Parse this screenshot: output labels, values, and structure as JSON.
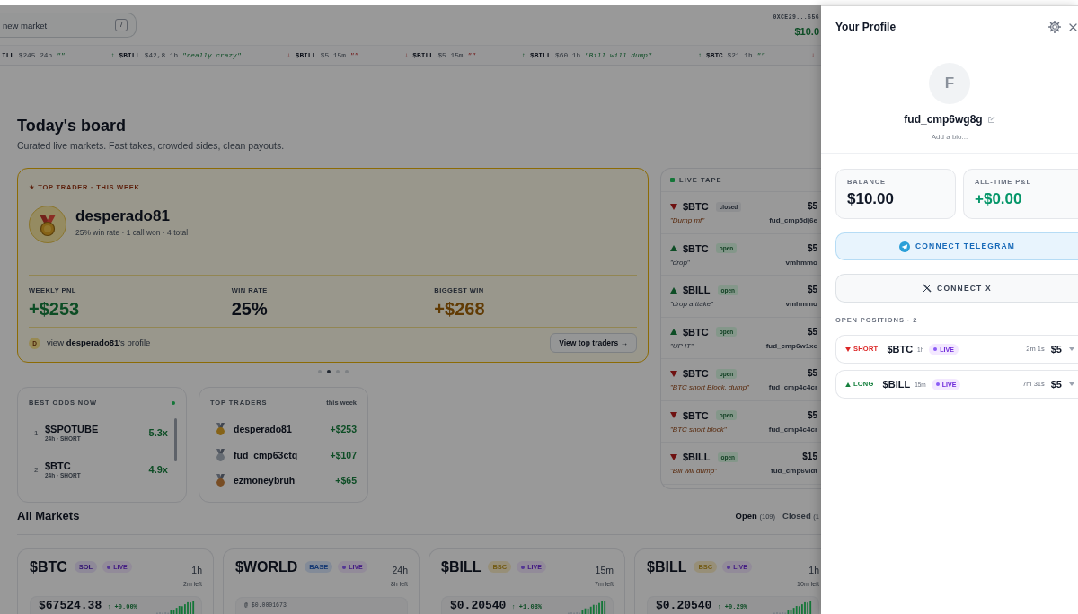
{
  "search": {
    "placeholder": "new market",
    "shortcut": "/"
  },
  "wallet": {
    "address": "0XCE29...656",
    "balance": "$10.0"
  },
  "ticker": [
    {
      "up": true,
      "token": "ILL",
      "amount": "$245",
      "duration": "24h",
      "quote": "\"\""
    },
    {
      "arrow": "↑",
      "up": true,
      "token": "$BILL",
      "amount": "$42,8",
      "duration": "1h",
      "quote": "\"really crazy\""
    },
    {
      "arrow": "↓",
      "up": false,
      "token": "$BILL",
      "amount": "$5",
      "duration": "15m",
      "quote": "\"\""
    },
    {
      "arrow": "↓",
      "up": false,
      "token": "$BILL",
      "amount": "$5",
      "duration": "15m",
      "quote": "\"\""
    },
    {
      "arrow": "↑",
      "up": true,
      "token": "$BILL",
      "amount": "$60",
      "duration": "1h",
      "quote": "\"Bill will dump\""
    },
    {
      "arrow": "↑",
      "up": true,
      "token": "$BTC",
      "amount": "$21",
      "duration": "1h",
      "quote": "\"\""
    },
    {
      "arrow": "↓",
      "up": false
    }
  ],
  "board": {
    "title": "Today's board",
    "subtitle": "Curated live markets. Fast takes, crowded sides, clean payouts."
  },
  "featured": {
    "label": "★ TOP TRADER · THIS WEEK",
    "name": "desperado81",
    "summary": "25% win rate · 1 call won · 4 total",
    "stats": [
      {
        "label": "WEEKLY PNL",
        "value": "+$253",
        "color": "#0d4d25"
      },
      {
        "label": "WIN RATE",
        "value": "25%",
        "color": "#0a0e17"
      },
      {
        "label": "BIGGEST WIN",
        "value": "+$268",
        "color": "#613b04"
      }
    ],
    "initial": "D",
    "profile_link": "view **desperado81**'s profile",
    "button": "View top traders →"
  },
  "carousel": {
    "dots": [
      {
        "selected": false
      },
      {
        "selected": true
      },
      {
        "selected": false
      },
      {
        "selected": false
      }
    ]
  },
  "best_odds": {
    "title": "BEST ODDS NOW",
    "rows": [
      {
        "rank": "1",
        "token": "$SPOTUBE",
        "detail": "24h · SHORT",
        "odds": "5.3x"
      },
      {
        "rank": "2",
        "token": "$BTC",
        "detail": "24h · SHORT",
        "odds": "4.9x"
      }
    ]
  },
  "top_traders": {
    "title": "TOP TRADERS",
    "period": "this week",
    "rows": [
      {
        "name": "desperado81",
        "pnl": "+$253",
        "color": "#866317"
      },
      {
        "name": "fud_cmp63ctq",
        "pnl": "+$107",
        "color": "#666c73"
      },
      {
        "name": "ezmoneybruh",
        "pnl": "+$65",
        "color": "#784d24"
      }
    ]
  },
  "live_tape": {
    "title": "LIVE TAPE",
    "rows": [
      {
        "up": false,
        "token": "$BTC",
        "badge": "closed",
        "closed": true,
        "amount": "$5",
        "quote": "\"Dump mf\"",
        "user": "fud_cmp5dj6e"
      },
      {
        "up": true,
        "token": "$BTC",
        "badge": "open",
        "closed": false,
        "amount": "$5",
        "quote": "\"drop\"",
        "user": "vmhmmo"
      },
      {
        "up": true,
        "token": "$BILL",
        "badge": "open",
        "closed": false,
        "amount": "$5",
        "quote": "\"drop a ttake\"",
        "user": "vmhmmo"
      },
      {
        "up": true,
        "token": "$BTC",
        "badge": "open",
        "closed": false,
        "amount": "$5",
        "quote": "\"UP IT\"",
        "user": "fud_cmp6w1xe"
      },
      {
        "up": false,
        "token": "$BTC",
        "badge": "open",
        "closed": false,
        "amount": "$5",
        "quote": "\"BTC short Block, dump\"",
        "user": "fud_cmp4c4cr"
      },
      {
        "up": false,
        "token": "$BTC",
        "badge": "open",
        "closed": false,
        "amount": "$5",
        "quote": "\"BTC short block\"",
        "user": "fud_cmp4c4cr"
      },
      {
        "up": false,
        "token": "$BILL",
        "badge": "open",
        "closed": false,
        "amount": "$15",
        "quote": "\"Bill will dump\"",
        "user": "fud_cmp6vldt"
      }
    ]
  },
  "markets": {
    "title": "All Markets",
    "filters": [
      {
        "label": "Open",
        "count": "(109)",
        "selected": true
      },
      {
        "label": "Closed",
        "count": "(1",
        "selected": false
      }
    ],
    "cards": [
      {
        "kind": "price",
        "token": "$BTC",
        "chain": "SOL",
        "color": "#8e8998",
        "live": "LIVE",
        "duration": "1h",
        "remaining": "2m left",
        "price": "$67524.38",
        "change": "↑ +0.00%"
      },
      {
        "kind": "entry",
        "token": "$WORLD",
        "chain": "BASE",
        "color": "#838b98",
        "live": "LIVE",
        "duration": "24h",
        "remaining": "8h left",
        "entry": "@ $0.0001673"
      },
      {
        "kind": "price",
        "token": "$BILL",
        "chain": "BSC",
        "color": "#978f78",
        "live": "LIVE",
        "duration": "15m",
        "remaining": "7m left",
        "price": "$0.20540",
        "change": "↑ +1.08%"
      },
      {
        "kind": "price",
        "token": "$BILL",
        "chain": "BSC",
        "color": "#978f78",
        "live": "LIVE",
        "duration": "1h",
        "remaining": "10m left",
        "price": "$0.20540",
        "change": "↑ +0.29%"
      }
    ]
  },
  "profile": {
    "title": "Your Profile",
    "initial": "F",
    "username": "fud_cmp6wg8g",
    "bio": {
      "placeholder": "Add a bio..."
    },
    "stats": [
      {
        "label": "BALANCE",
        "value": "$10.00",
        "color": "#111827"
      },
      {
        "label": "ALL-TIME P&L",
        "value": "+$0.00",
        "color": "#059669"
      }
    ],
    "connect": [
      {
        "kind": "telegram",
        "label": "CONNECT TELEGRAM"
      },
      {
        "kind": "x",
        "label": "CONNECT X"
      }
    ],
    "positions_title": "OPEN POSITIONS · 2",
    "positions": [
      {
        "up": false,
        "side": "SHORT",
        "token": "$BTC",
        "duration": "1h",
        "live": "LIVE",
        "remaining": "2m 1s",
        "amount": "$5"
      },
      {
        "up": true,
        "side": "LONG",
        "token": "$BILL",
        "duration": "15m",
        "live": "LIVE",
        "remaining": "7m 31s",
        "amount": "$5"
      }
    ]
  }
}
